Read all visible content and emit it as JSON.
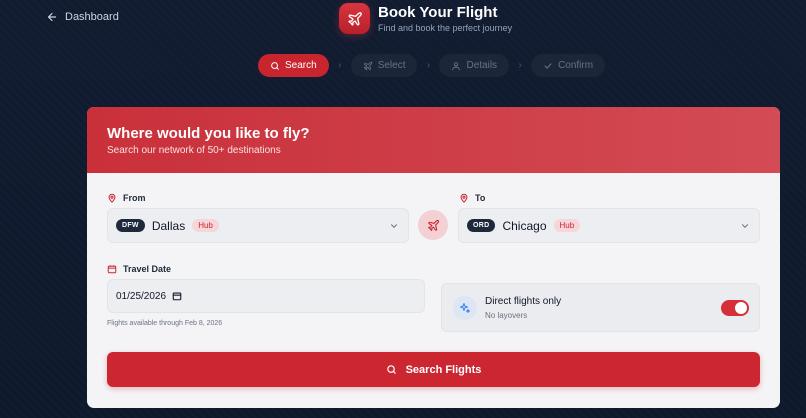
{
  "nav": {
    "back_label": "Dashboard"
  },
  "brand": {
    "title": "Book Your Flight",
    "subtitle": "Find and book the perfect journey"
  },
  "steps": [
    {
      "label": "Search",
      "icon": "search-icon",
      "active": true
    },
    {
      "label": "Select",
      "icon": "plane-icon",
      "active": false
    },
    {
      "label": "Details",
      "icon": "user-icon",
      "active": false
    },
    {
      "label": "Confirm",
      "icon": "check-icon",
      "active": false
    }
  ],
  "card": {
    "title": "Where would you like to fly?",
    "subtitle": "Search our network of 50+ destinations"
  },
  "from": {
    "label": "From",
    "code": "DFW",
    "city": "Dallas",
    "badge": "Hub"
  },
  "to": {
    "label": "To",
    "code": "ORD",
    "city": "Chicago",
    "badge": "Hub"
  },
  "travel_date": {
    "label": "Travel Date",
    "value": "01/25/2026",
    "hint": "Flights available through Feb 8, 2026"
  },
  "direct": {
    "title": "Direct flights only",
    "subtitle": "No layovers",
    "enabled": true
  },
  "search_button": {
    "label": "Search Flights"
  },
  "colors": {
    "accent": "#cc2631",
    "background": "#0f1a2e",
    "card": "#f4f4f6"
  }
}
